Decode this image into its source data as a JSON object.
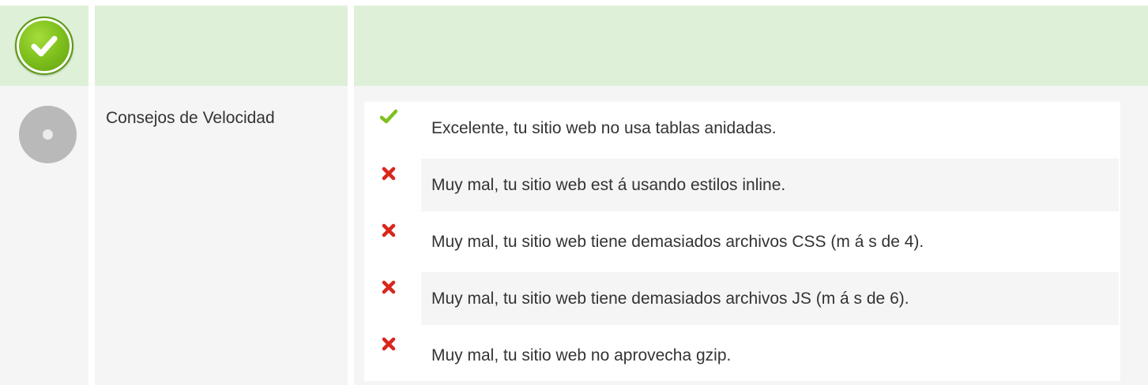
{
  "colors": {
    "header_bg": "#dff0d8",
    "body_bg": "#f5f5f5",
    "success": "#7fc11d",
    "error": "#d9261c",
    "neutral_badge": "#b9b9b9"
  },
  "header": {
    "status_icon": "check-circle-icon"
  },
  "section": {
    "status_icon": "neutral-circle-icon",
    "title": "Consejos de Velocidad"
  },
  "checks": [
    {
      "status": "pass",
      "icon": "checkmark-icon",
      "text": "Excelente, tu sitio web no usa tablas anidadas."
    },
    {
      "status": "fail",
      "icon": "cross-icon",
      "text": "Muy mal, tu sitio web est á  usando estilos inline."
    },
    {
      "status": "fail",
      "icon": "cross-icon",
      "text": "Muy mal, tu sitio web tiene demasiados archivos CSS (m á s de 4)."
    },
    {
      "status": "fail",
      "icon": "cross-icon",
      "text": "Muy mal, tu sitio web tiene demasiados archivos JS (m á s de 6)."
    },
    {
      "status": "fail",
      "icon": "cross-icon",
      "text": "Muy mal, tu sitio web no aprovecha gzip."
    }
  ]
}
